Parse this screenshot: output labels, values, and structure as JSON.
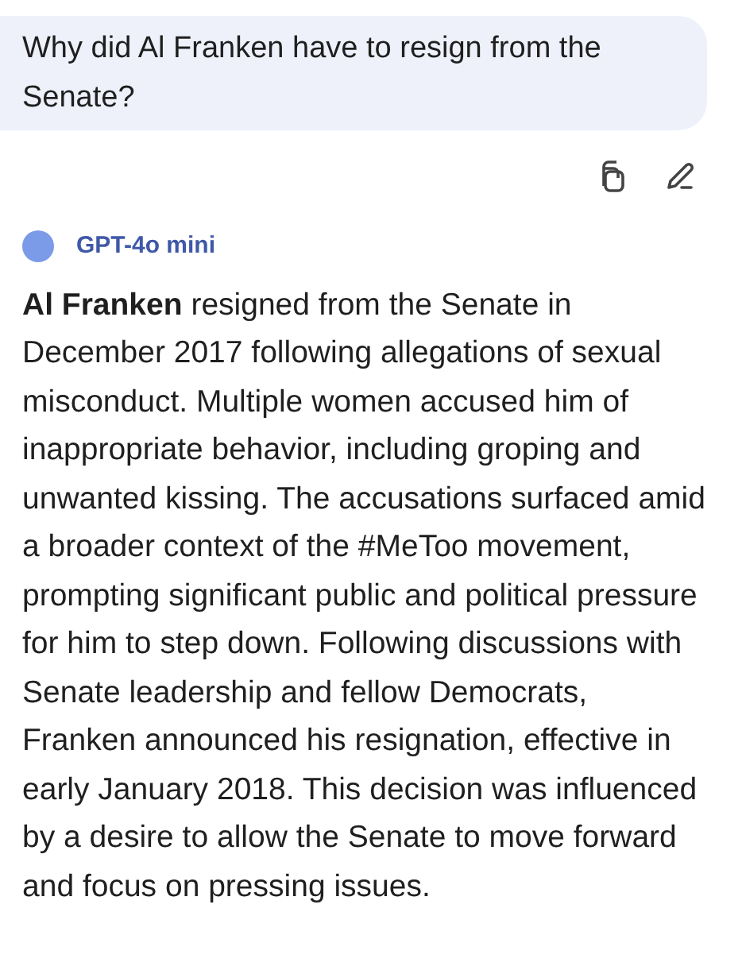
{
  "user_message": {
    "text": "Why did Al Franken have to resign from the Senate?"
  },
  "message_actions": [
    {
      "kind": "copy"
    },
    {
      "kind": "edit"
    }
  ],
  "response": {
    "model": "GPT-4o mini",
    "text": "**Al Franken** resigned from the Senate in December 2017 following allegations of sexual misconduct. Multiple women accused him of inappropriate behavior, including groping and unwanted kissing. The accusations surfaced amid a broader context of the #MeToo movement, prompting significant public and political pressure for him to step down. Following discussions with Senate leadership and fellow Democrats, Franken announced his resignation, effective in early January 2018. This decision was influenced by a desire to allow the Senate to move forward and focus on pressing issues."
  }
}
